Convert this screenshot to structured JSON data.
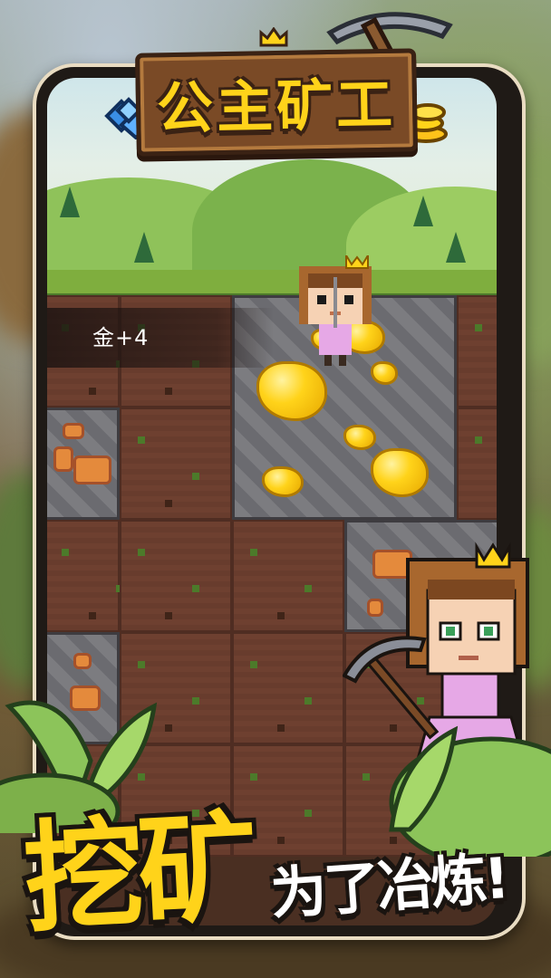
{
  "logo": {
    "title": "公主矿工"
  },
  "hud": {
    "reward_text": "金+4"
  },
  "slogan": {
    "main": "挖矿",
    "sub": "为了冶炼!"
  },
  "colors": {
    "gold": "#ffd31a",
    "dirt": "#6e4030",
    "stone": "#7c7c80",
    "copper": "#e48a3c",
    "dress": "#e6a8e6"
  },
  "icons": [
    "crown-icon",
    "pickaxe-icon",
    "gem-stack-icon",
    "gold-coin-icon",
    "gold-ore-icon",
    "copper-ore-icon",
    "leaf-icon"
  ]
}
